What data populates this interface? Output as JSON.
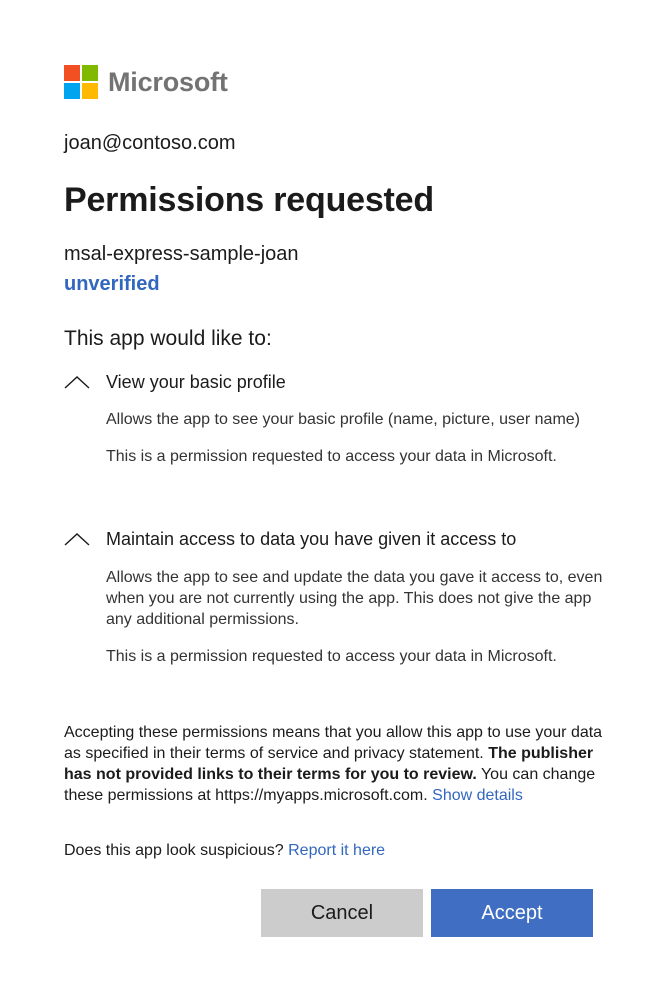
{
  "brand": {
    "name": "Microsoft",
    "logo_colors": [
      "#f25022",
      "#7fba00",
      "#00a4ef",
      "#ffb900"
    ]
  },
  "account": "joan@contoso.com",
  "title": "Permissions requested",
  "app": {
    "name": "msal-express-sample-joan",
    "verification": "unverified"
  },
  "lead": "This app would like to:",
  "permissions": [
    {
      "title": "View your basic profile",
      "icon": "chevron-up-icon",
      "description": "Allows the app to see your basic profile (name, picture, user name)",
      "note": "This is a permission requested to access your data in Microsoft."
    },
    {
      "title": "Maintain access to data you have given it access to",
      "icon": "chevron-up-icon",
      "description": "Allows the app to see and update the data you gave it access to, even when you are not currently using the app. This does not give the app any additional permissions.",
      "note": "This is a permission requested to access your data in Microsoft."
    }
  ],
  "notice": {
    "text_before": "Accepting these permissions means that you allow this app to use your data as specified in their terms of service and privacy statement. ",
    "bold": "The publisher has not provided links to their terms for you to review.",
    "text_after": " You can change these permissions at https://myapps.microsoft.com. ",
    "link": "Show details"
  },
  "suspicious": {
    "question": "Does this app look suspicious? ",
    "link": "Report it here"
  },
  "buttons": {
    "cancel": "Cancel",
    "accept": "Accept"
  },
  "colors": {
    "link": "#3267bf",
    "accept_bg": "#3f6ec2",
    "cancel_bg": "#cccccc"
  }
}
